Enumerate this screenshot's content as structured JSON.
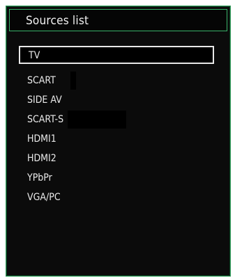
{
  "sources": {
    "title": "Sources list",
    "items": [
      {
        "label": "TV",
        "selected": true
      },
      {
        "label": "SCART",
        "selected": false
      },
      {
        "label": "SIDE AV",
        "selected": false
      },
      {
        "label": "SCART-S",
        "selected": false
      },
      {
        "label": "HDMI1",
        "selected": false
      },
      {
        "label": "HDMI2",
        "selected": false
      },
      {
        "label": "YPbPr",
        "selected": false
      },
      {
        "label": "VGA/PC",
        "selected": false
      }
    ]
  },
  "colors": {
    "panel_bg": "#0b0b0b",
    "border_green": "#39b36a",
    "text": "#eaeaea",
    "selection_border": "#e9e9e9"
  }
}
